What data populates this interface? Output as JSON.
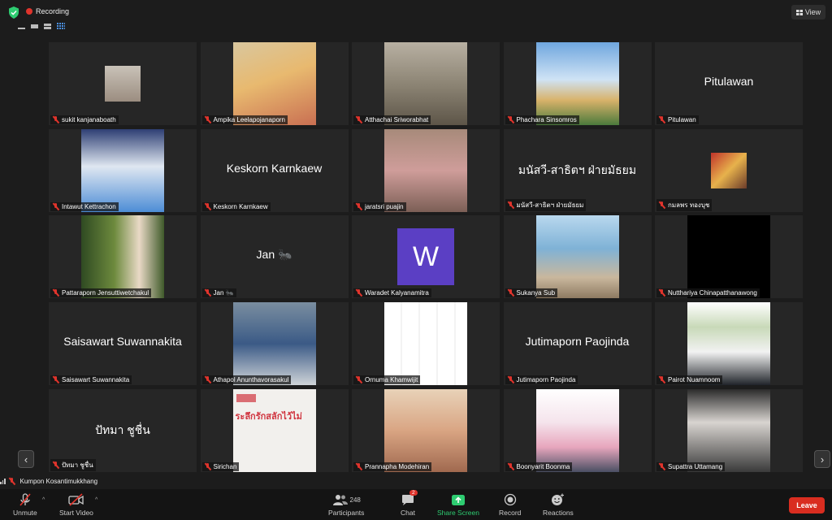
{
  "topbar": {
    "recording_label": "Recording",
    "view_label": "View"
  },
  "speaker": {
    "name": "Kumpon Kosantimukkhang"
  },
  "colors": {
    "background": "#1c1c1c",
    "tile": "#262626",
    "record": "#e0342c",
    "leave": "#d92d20",
    "share": "#2ecc71"
  },
  "participants": [
    {
      "name": "sukit kanjanaboath",
      "kind": "photo-small",
      "display": ""
    },
    {
      "name": "Ampika Leelapojanaporn",
      "kind": "photo",
      "display": ""
    },
    {
      "name": "Atthachai Sriworabhat",
      "kind": "photo",
      "display": ""
    },
    {
      "name": "Phachara Sinsomros",
      "kind": "photo",
      "display": ""
    },
    {
      "name": "Pitulawan",
      "kind": "text",
      "display": "Pitulawan"
    },
    {
      "name": "Intawut Kettrachon",
      "kind": "photo",
      "display": ""
    },
    {
      "name": "Keskorn Karnkaew",
      "kind": "text",
      "display": "Keskorn Karnkaew"
    },
    {
      "name": "jaratsri puajin",
      "kind": "photo",
      "display": ""
    },
    {
      "name": "มนัสวี-สาธิตฯ ฝ่ายมัธยม",
      "kind": "text",
      "display": "มนัสวี-สาธิตฯ ฝ่ายมัธยม"
    },
    {
      "name": "กมลพร ทองบุช",
      "kind": "photo-small",
      "display": ""
    },
    {
      "name": "Pattaraporn Jensuttiwetchakul",
      "kind": "photo",
      "display": ""
    },
    {
      "name": "Jan 🐜",
      "kind": "text",
      "display": "Jan 🐜"
    },
    {
      "name": "Waradet Kalyanamitra",
      "kind": "letter",
      "display": "W"
    },
    {
      "name": "Sukanya Sub",
      "kind": "photo",
      "display": ""
    },
    {
      "name": "Nutthariya Chinapatthanawong",
      "kind": "black",
      "display": ""
    },
    {
      "name": "Saisawart Suwannakita",
      "kind": "text",
      "display": "Saisawart Suwannakita"
    },
    {
      "name": "Athapol Anunthavorasakul",
      "kind": "photo",
      "display": ""
    },
    {
      "name": "Ornuma Khamwijit",
      "kind": "drawing",
      "display": ""
    },
    {
      "name": "Jutimaporn Paojinda",
      "kind": "text",
      "display": "Jutimaporn Paojinda"
    },
    {
      "name": "Pairot Nuamnoom",
      "kind": "photo",
      "display": ""
    },
    {
      "name": "ปัทมา ชูชื่น",
      "kind": "text",
      "display": "ปัทมา ชูชื่น"
    },
    {
      "name": "Sirichan",
      "kind": "poster",
      "display": "ระลึกรักสลักไว้ไม่"
    },
    {
      "name": "Prannapha Modehiran",
      "kind": "photo",
      "display": ""
    },
    {
      "name": "Boonyarit Boonma",
      "kind": "photo",
      "display": ""
    },
    {
      "name": "Supattra Uttamang",
      "kind": "photo",
      "display": ""
    }
  ],
  "toolbar": {
    "unmute": "Unmute",
    "start_video": "Start Video",
    "participants": "Participants",
    "participant_count": "248",
    "chat": "Chat",
    "chat_badge": "2",
    "share_screen": "Share Screen",
    "record": "Record",
    "reactions": "Reactions",
    "leave": "Leave"
  }
}
